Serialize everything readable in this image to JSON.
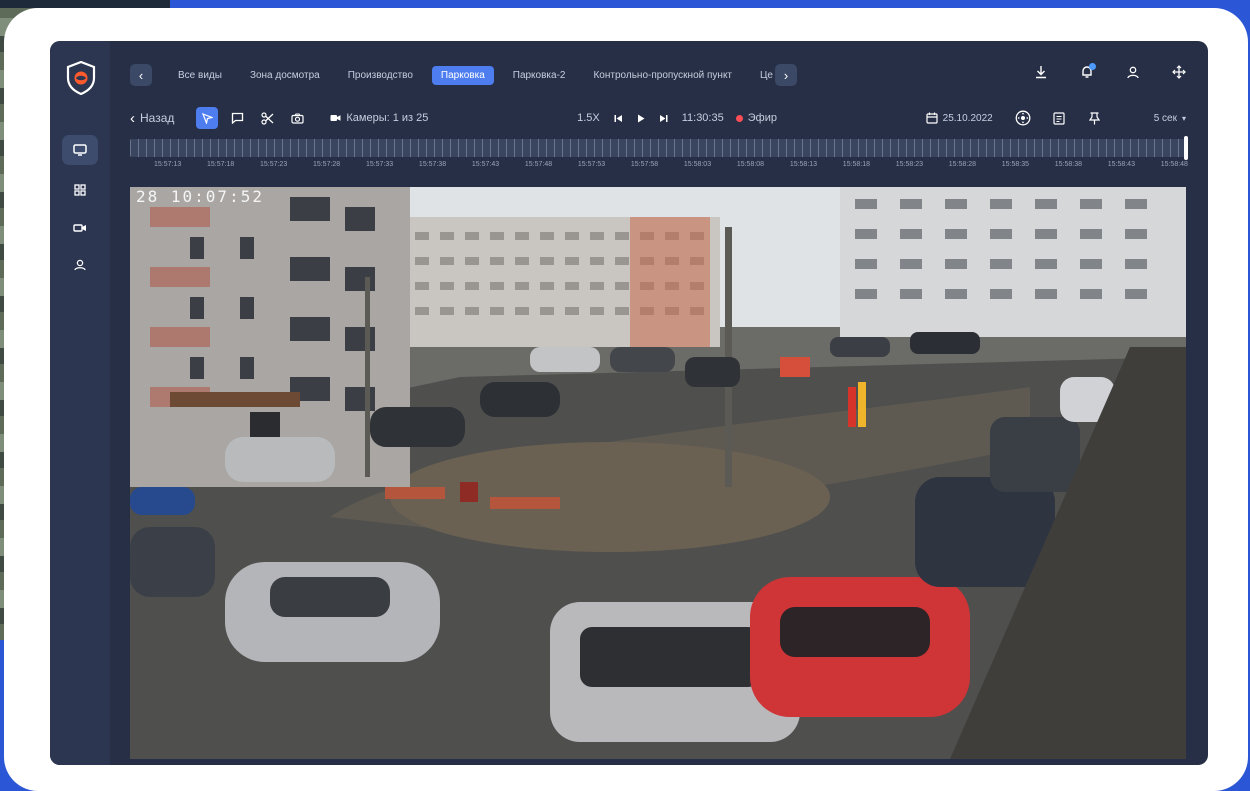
{
  "tabs": {
    "items": [
      "Все виды",
      "Зона досмотра",
      "Производство",
      "Парковка",
      "Парковка-2",
      "Контрольно-пропускной пункт",
      "Це"
    ],
    "active_index": 3
  },
  "toolbar": {
    "back_label": "Назад",
    "cameras_label": "Камеры: 1 из 25",
    "speed": "1.5X",
    "time": "11:30:35",
    "live_label": "Эфир",
    "date": "25.10.2022",
    "interval": "5 сек"
  },
  "timeline": {
    "ticks": [
      "15:57:13",
      "15:57:18",
      "15:57:23",
      "15:57:28",
      "15:57:33",
      "15:57:38",
      "15:57:43",
      "15:57:48",
      "15:57:53",
      "15:57:58",
      "15:58:03",
      "15:58:08",
      "15:58:13",
      "15:58:18",
      "15:58:23",
      "15:58:28",
      "15:58:35",
      "15:58:38",
      "15:58:43",
      "15:58:48"
    ]
  },
  "video": {
    "osd": "28 10:07:52"
  },
  "colors": {
    "accent": "#4e7df0",
    "live": "#ff4d57",
    "app_bg": "#262f45",
    "sidebar_bg": "#2c3650",
    "page_bg": "#2b57d6"
  },
  "icons": {
    "sidebar": [
      "monitor-icon",
      "grid-icon",
      "camera-icon",
      "users-icon"
    ],
    "top": [
      "download-icon",
      "bell-icon",
      "user-icon",
      "move-icon"
    ]
  }
}
